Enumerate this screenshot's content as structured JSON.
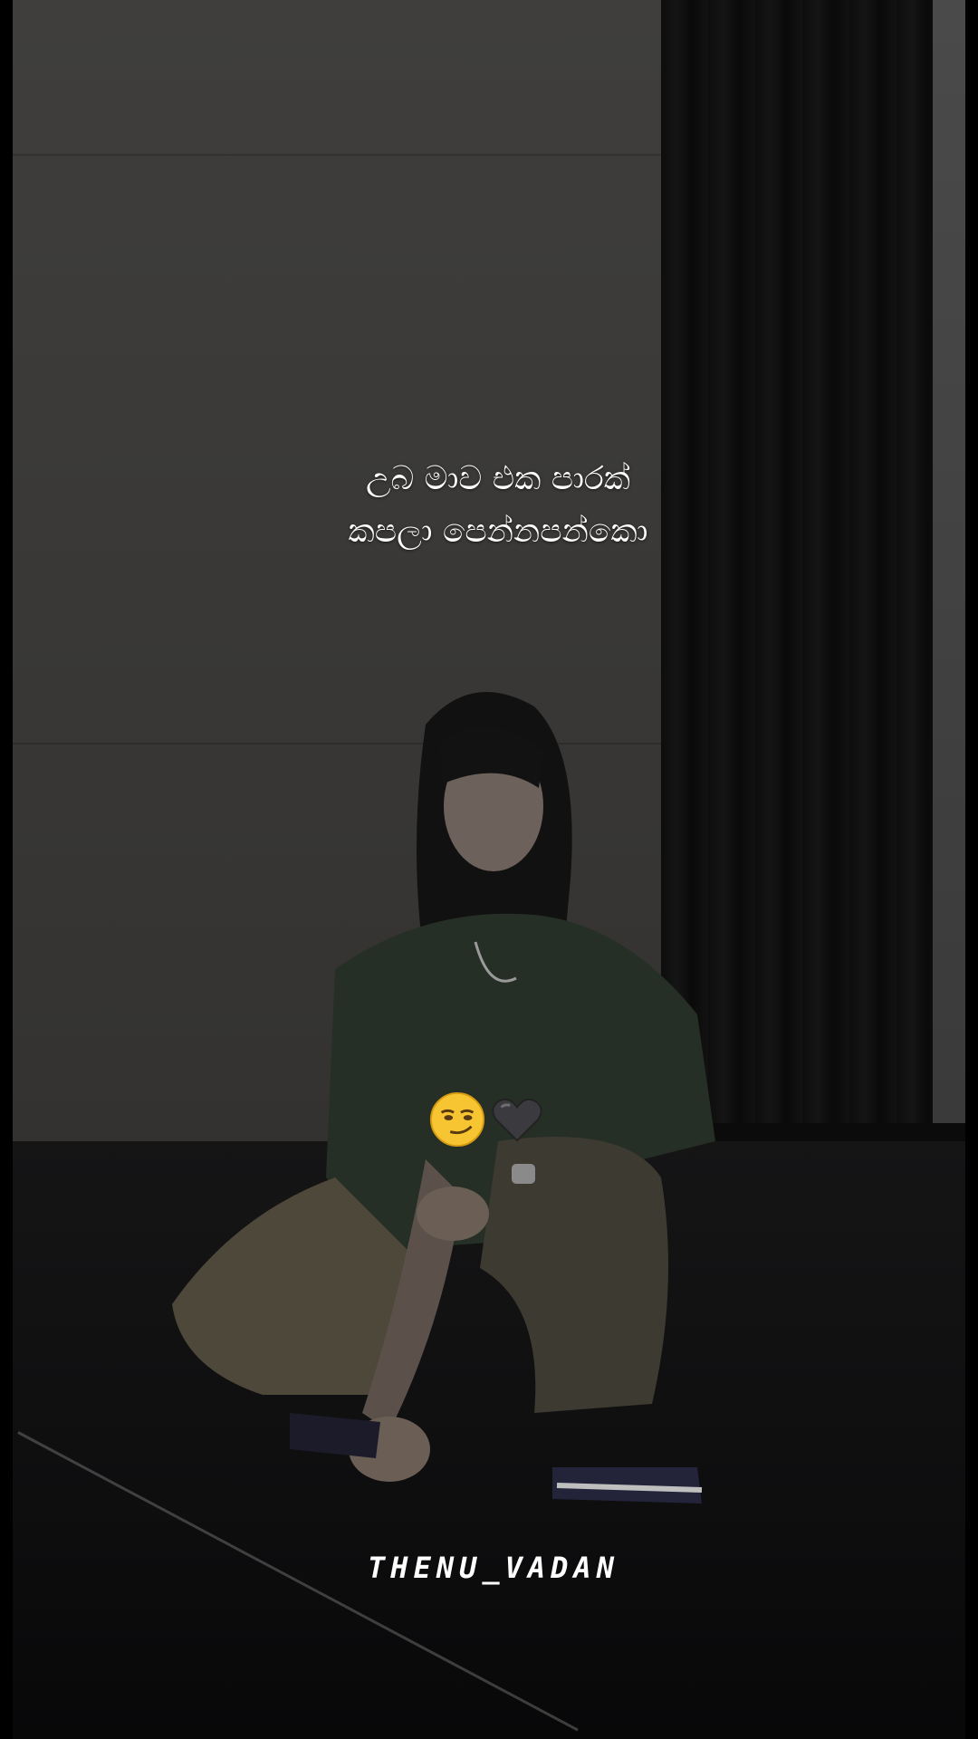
{
  "caption": {
    "line1": "උබ මාව එක පාරක්",
    "line2": "කපලා පෙන්නපන්කො"
  },
  "emojis": [
    "smirking-face-emoji",
    "black-heart-emoji"
  ],
  "watermark": "THENU_VADAN",
  "colors": {
    "wall": "#3a3937",
    "curtain": "#0f0f10",
    "floor": "#0e0e0f",
    "shirt": "#273026",
    "pants": "#4a4538",
    "caption_text": "#ffffff"
  }
}
